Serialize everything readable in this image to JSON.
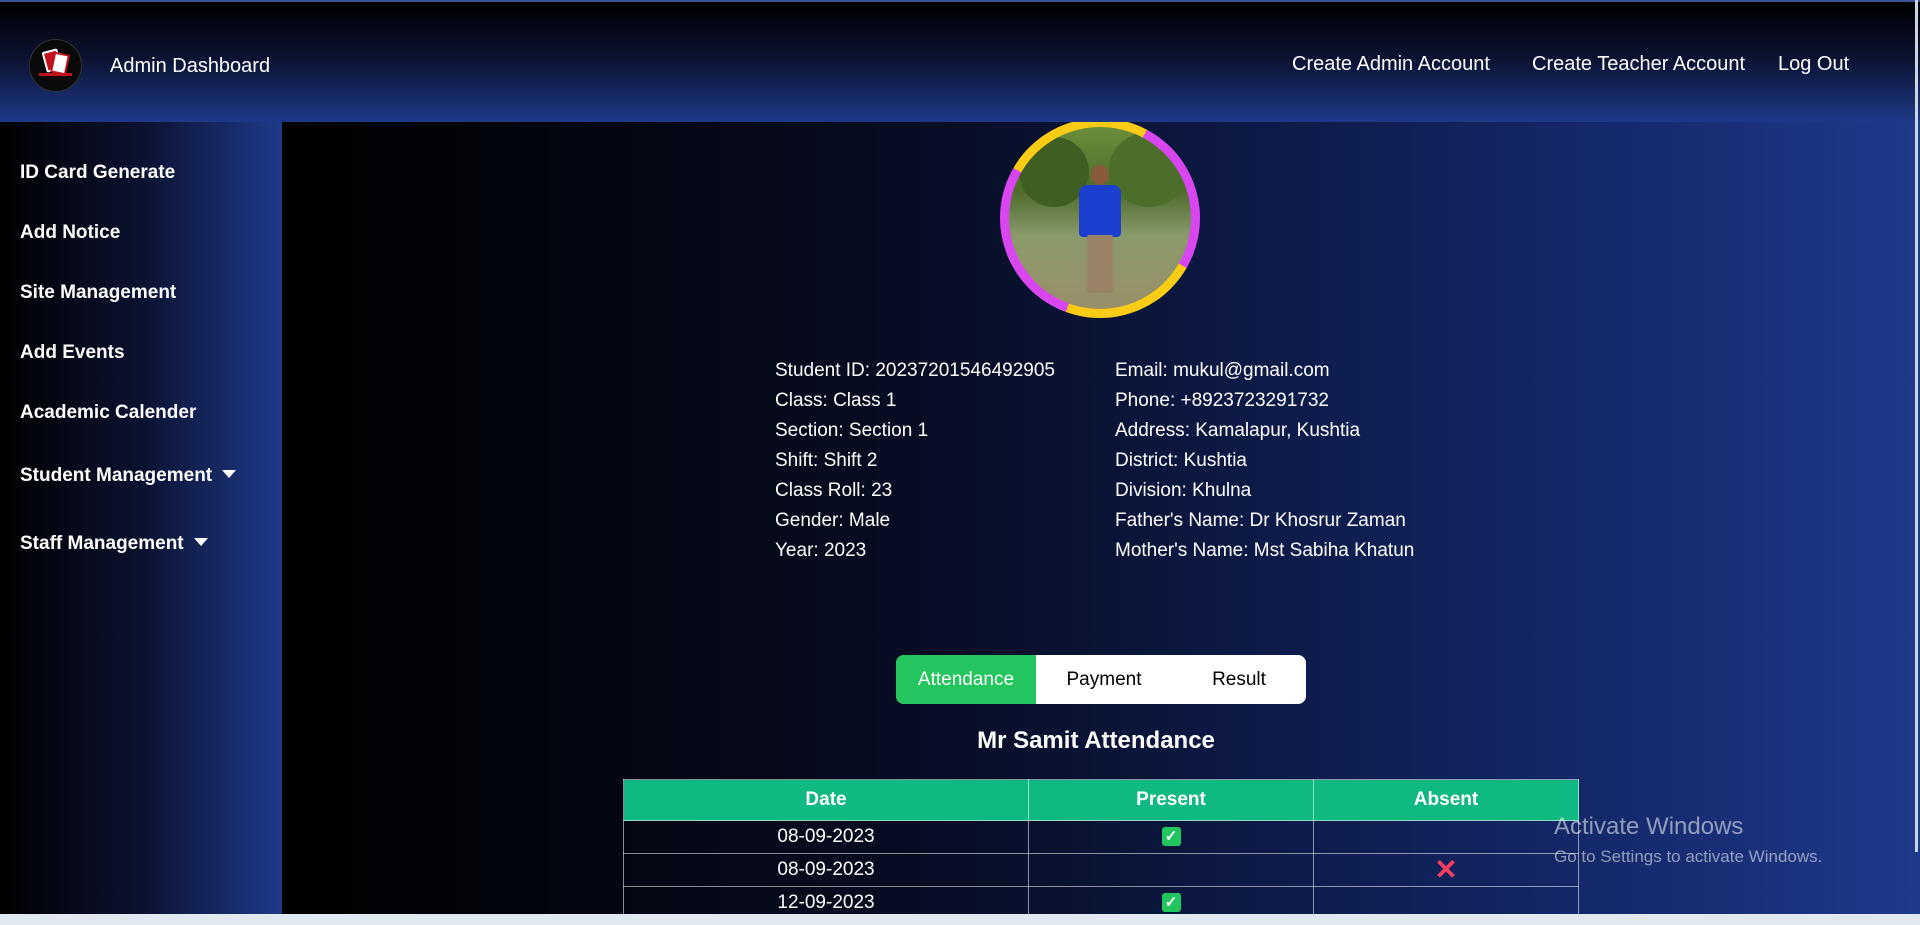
{
  "header": {
    "brand": "Admin Dashboard",
    "nav": [
      "Create Admin Account",
      "Create Teacher Account",
      "Log Out"
    ]
  },
  "sidebar": {
    "items": [
      {
        "label": "ID Card Generate"
      },
      {
        "label": "Add Notice"
      },
      {
        "label": "Site Management"
      },
      {
        "label": "Add Events"
      },
      {
        "label": "Academic Calender"
      },
      {
        "label": "Student Management"
      },
      {
        "label": "Staff Management"
      }
    ]
  },
  "student": {
    "left": [
      "Student ID: 20237201546492905",
      "Class: Class 1",
      "Section: Section 1",
      "Shift: Shift 2",
      "Class Roll: 23",
      "Gender: Male",
      "Year: 2023"
    ],
    "right": [
      "Email: mukul@gmail.com",
      "Phone: +8923723291732",
      "Address: Kamalapur, Kushtia",
      "District: Kushtia",
      "Division: Khulna",
      "Father's Name: Dr Khosrur Zaman",
      "Mother's Name: Mst Sabiha Khatun"
    ]
  },
  "tabs": [
    "Attendance",
    "Payment",
    "Result"
  ],
  "attendance": {
    "title": "Mr Samit Attendance",
    "headers": [
      "Date",
      "Present",
      "Absent"
    ],
    "rows": [
      {
        "date": "08-09-2023",
        "status": "present"
      },
      {
        "date": "08-09-2023",
        "status": "absent"
      },
      {
        "date": "12-09-2023",
        "status": "present"
      }
    ]
  },
  "watermark": {
    "line1": "Activate Windows",
    "line2": "Go to Settings to activate Windows."
  },
  "colors": {
    "accent_green": "#22c55e",
    "table_header": "#10b981",
    "absent_red": "#f43f5e",
    "ring_yellow": "#facc15",
    "ring_magenta": "#d946ef"
  }
}
